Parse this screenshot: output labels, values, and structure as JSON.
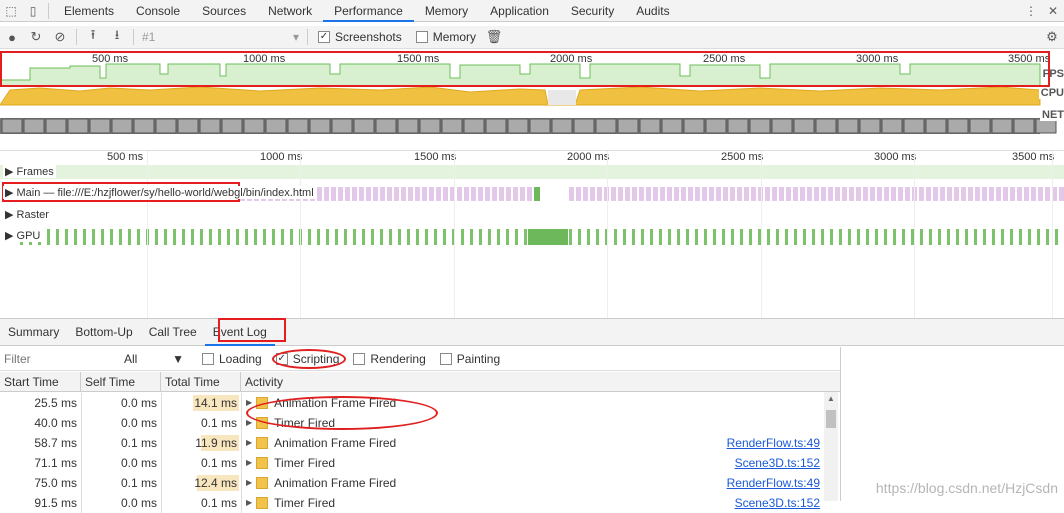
{
  "tabs": [
    "Elements",
    "Console",
    "Sources",
    "Network",
    "Performance",
    "Memory",
    "Application",
    "Security",
    "Audits"
  ],
  "active_tab": "Performance",
  "toolbar": {
    "recording_select": "#1",
    "screenshots_label": "Screenshots",
    "memory_label": "Memory"
  },
  "overview_ruler": [
    "500 ms",
    "1000 ms",
    "1500 ms",
    "2000 ms",
    "2500 ms",
    "3000 ms",
    "3500 ms"
  ],
  "overview_tracks": {
    "fps": "FPS",
    "cpu": "CPU",
    "net": "NET"
  },
  "flame_ruler": [
    "500 ms",
    "1000 ms",
    "1500 ms",
    "2000 ms",
    "2500 ms",
    "3000 ms",
    "3500 ms"
  ],
  "flame_tracks": {
    "frames": "Frames",
    "main": "Main — file:///E:/hzjflower/sy/hello-world/webgl/bin/index.html",
    "raster": "Raster",
    "gpu": "GPU"
  },
  "subtabs": [
    "Summary",
    "Bottom-Up",
    "Call Tree",
    "Event Log"
  ],
  "active_subtab": "Event Log",
  "filters": {
    "placeholder": "Filter",
    "all": "All",
    "loading": "Loading",
    "scripting": "Scripting",
    "rendering": "Rendering",
    "painting": "Painting"
  },
  "columns": [
    "Start Time",
    "Self Time",
    "Total Time",
    "Activity"
  ],
  "events": [
    {
      "start": "25.5 ms",
      "self": "0.0 ms",
      "total": "14.1 ms",
      "activity": "Animation Frame Fired",
      "link": "",
      "bar": 0.6
    },
    {
      "start": "40.0 ms",
      "self": "0.0 ms",
      "total": "0.1 ms",
      "activity": "Timer Fired",
      "link": "",
      "bar": 0
    },
    {
      "start": "58.7 ms",
      "self": "0.1 ms",
      "total": "11.9 ms",
      "activity": "Animation Frame Fired",
      "link": "RenderFlow.ts:49",
      "bar": 0.5
    },
    {
      "start": "71.1 ms",
      "self": "0.0 ms",
      "total": "0.1 ms",
      "activity": "Timer Fired",
      "link": "Scene3D.ts:152",
      "bar": 0
    },
    {
      "start": "75.0 ms",
      "self": "0.1 ms",
      "total": "12.4 ms",
      "activity": "Animation Frame Fired",
      "link": "RenderFlow.ts:49",
      "bar": 0.55
    },
    {
      "start": "91.5 ms",
      "self": "0.0 ms",
      "total": "0.1 ms",
      "activity": "Timer Fired",
      "link": "Scene3D.ts:152",
      "bar": 0
    }
  ],
  "watermark": "https://blog.csdn.net/HzjCsdn",
  "colors": {
    "accent": "#1a73e8",
    "fps": "#8fd17a",
    "cpu": "#f0c040",
    "scripting": "#f1c34a",
    "rendering": "#c99fe0",
    "annotation": "#e41e1e"
  }
}
